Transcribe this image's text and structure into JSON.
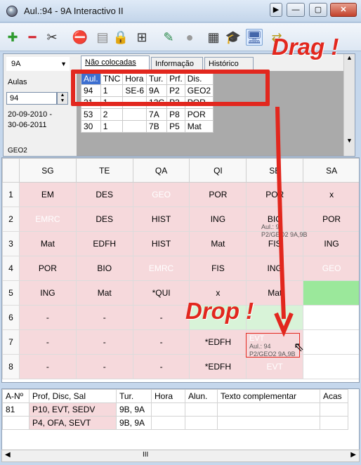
{
  "window": {
    "title": "Aul.:94 - 9A  Interactivo II",
    "buttons": [
      "▶",
      "—",
      "▢",
      "✕"
    ]
  },
  "toolbar": {
    "icons": [
      "add-icon",
      "remove-icon",
      "scissors-icon",
      "cancel-document-icon",
      "printer-icon",
      "lock-icon",
      "grid-icon",
      "paint-icon",
      "circle-icon",
      "calculator-icon",
      "graduation-cap-icon",
      "monitor-palette-icon",
      "swap-icon"
    ],
    "glyphs": [
      "✚",
      "━",
      "✂",
      "⛔",
      "▤",
      "🔒",
      "⊞",
      "✎",
      "●",
      "▦",
      "🎓",
      "🖥",
      "⇄"
    ]
  },
  "top": {
    "class_select": "9A",
    "aulas_label": "Aulas",
    "aulas_value": "94",
    "date_from": "20-09-2010 -",
    "date_to": "30-06-2011",
    "geo_label": "GEO2",
    "tabs": [
      "Não colocadas",
      "Informação",
      "Histórico"
    ],
    "table_headers": [
      "Aul.",
      "TNC",
      "Hora",
      "Tur.",
      "Prf.",
      "Dis."
    ],
    "table_rows": [
      [
        "94",
        "1",
        "SE-6",
        "9A",
        "P2",
        "GEO2"
      ],
      [
        "21",
        "1",
        "",
        "12C",
        "P3",
        "POR"
      ],
      [
        "53",
        "2",
        "",
        "7A",
        "P8",
        "POR"
      ],
      [
        "30",
        "1",
        "",
        "7B",
        "P5",
        "Mat"
      ]
    ]
  },
  "annotations": {
    "drag": "Drag !",
    "drop": "Drop !"
  },
  "timetable": {
    "days": [
      "SG",
      "TE",
      "QA",
      "QI",
      "SE",
      "SA"
    ],
    "rows": [
      {
        "n": "1",
        "cells": [
          "EM",
          "DES",
          "GEO",
          "POR",
          "POR",
          "x"
        ]
      },
      {
        "n": "2",
        "cells": [
          "EMRC",
          "DES",
          "HIST",
          "ING",
          "BIO",
          "POR"
        ]
      },
      {
        "n": "3",
        "cells": [
          "Mat",
          "EDFH",
          "HIST",
          "Mat",
          "FIS",
          "ING"
        ]
      },
      {
        "n": "4",
        "cells": [
          "POR",
          "BIO",
          "EMRC",
          "FIS",
          "ING",
          "GEO"
        ]
      },
      {
        "n": "5",
        "cells": [
          "ING",
          "Mat",
          "*QUI",
          "x",
          "Mat",
          ""
        ]
      },
      {
        "n": "6",
        "cells": [
          "-",
          "-",
          "-",
          "",
          "",
          ""
        ]
      },
      {
        "n": "7",
        "cells": [
          "-",
          "-",
          "-",
          "*EDFH",
          "EVT",
          ""
        ]
      },
      {
        "n": "8",
        "cells": [
          "-",
          "-",
          "-",
          "*EDFH",
          "EVT",
          ""
        ]
      }
    ],
    "ghost_top": [
      "Aul.: 94",
      "P2/GEO2  9A,9B"
    ],
    "ghost_target": [
      "Aul.: 94",
      "P2/GEO2  9A,9B"
    ]
  },
  "bottom": {
    "headers": [
      "A-Nº",
      "Prof, Disc, Sal",
      "Tur.",
      "Hora",
      "Alun.",
      "Texto complementar",
      "Acas"
    ],
    "rows": [
      [
        "81",
        "P10, EVT, SEDV",
        "9B, 9A",
        "",
        "",
        "",
        ""
      ],
      [
        "",
        "P4, OFA, SEVT",
        "9B, 9A",
        "",
        "",
        "",
        ""
      ]
    ]
  },
  "scrollbar": {
    "left": "◀",
    "thumb": "III",
    "right": "▶"
  }
}
